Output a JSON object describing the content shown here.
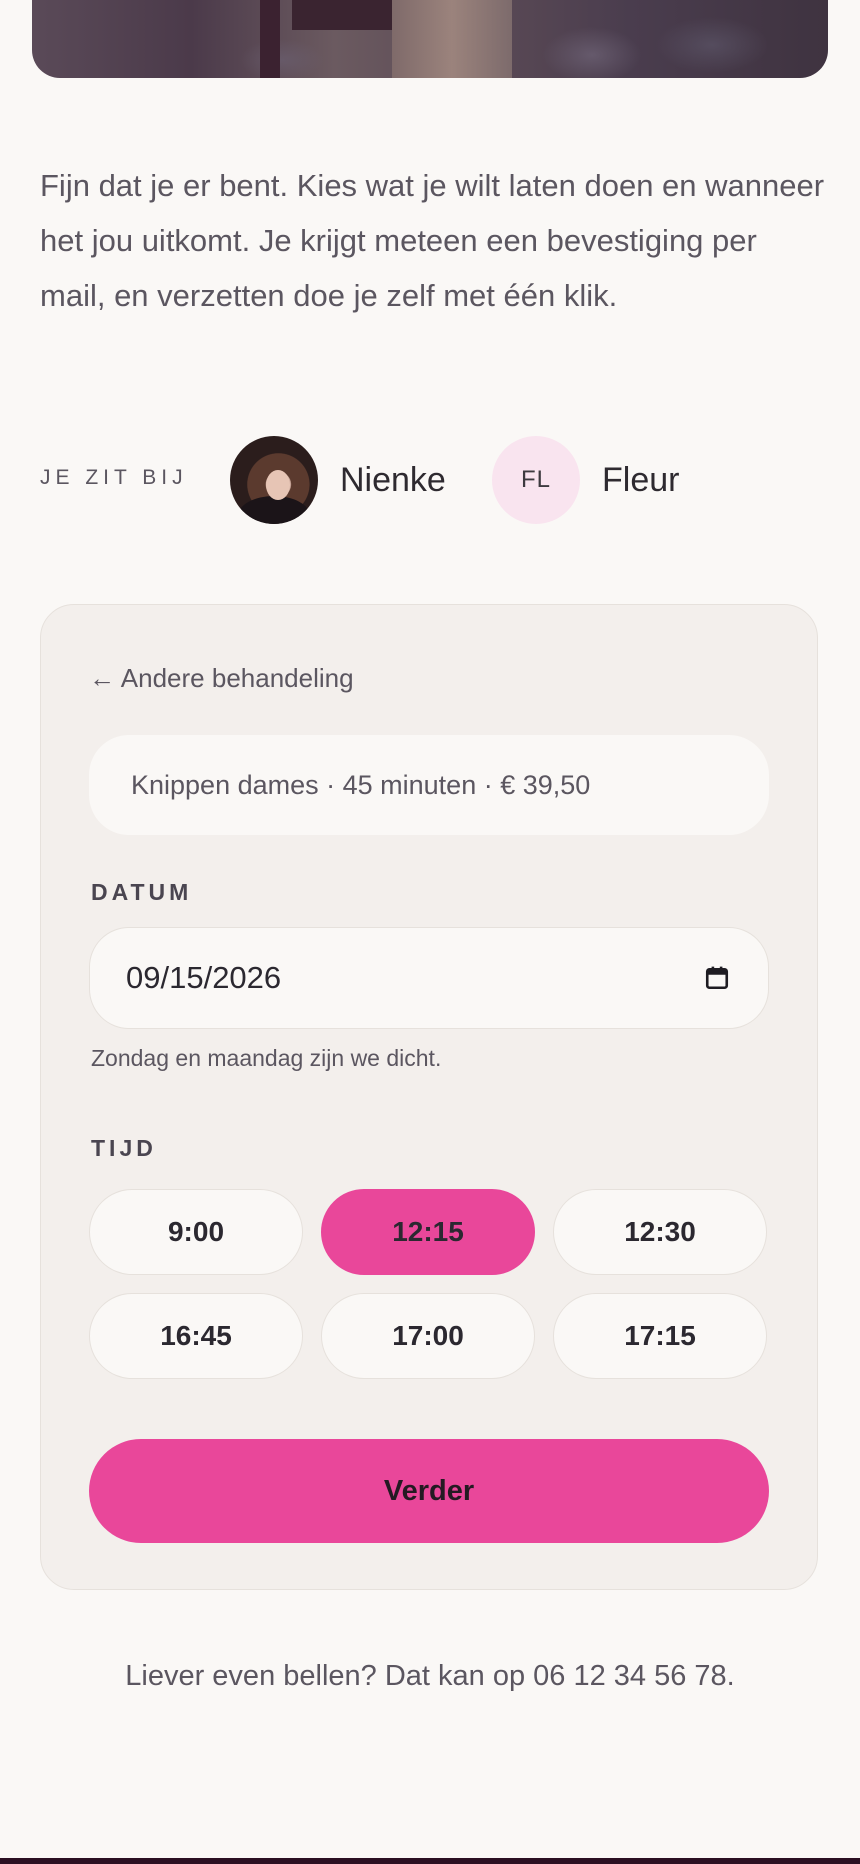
{
  "intro": {
    "text": "Fijn dat je er bent. Kies wat je wilt laten doen en wanneer het jou uitkomt. Je krijgt meteen een bevestiging per mail, en verzetten doe je zelf met één klik."
  },
  "stylists": {
    "label": "JE ZIT BIJ",
    "items": [
      {
        "name": "Nienke",
        "avatar": "photo"
      },
      {
        "name": "Fleur",
        "initials": "FL"
      }
    ]
  },
  "booking": {
    "back_label": "← Andere behandeling",
    "service_summary": "Knippen dames · 45 minuten · € 39,50",
    "date_label": "DATUM",
    "date_value": "09/15/2026",
    "date_hint": "Zondag en maandag zijn we dicht.",
    "time_label": "TIJD",
    "times": [
      "9:00",
      "12:15",
      "12:30",
      "16:45",
      "17:00",
      "17:15"
    ],
    "selected_time": "12:15",
    "next_label": "Verder"
  },
  "footer": {
    "call_text": "Liever even bellen? Dat kan op 06 12 34 56 78."
  },
  "colors": {
    "accent": "#e9479a",
    "background": "#faf8f6",
    "card": "#f3efec",
    "avatar_initials_bg": "#f9e4ef"
  },
  "icons": {
    "date_picker": "calendar-icon"
  }
}
